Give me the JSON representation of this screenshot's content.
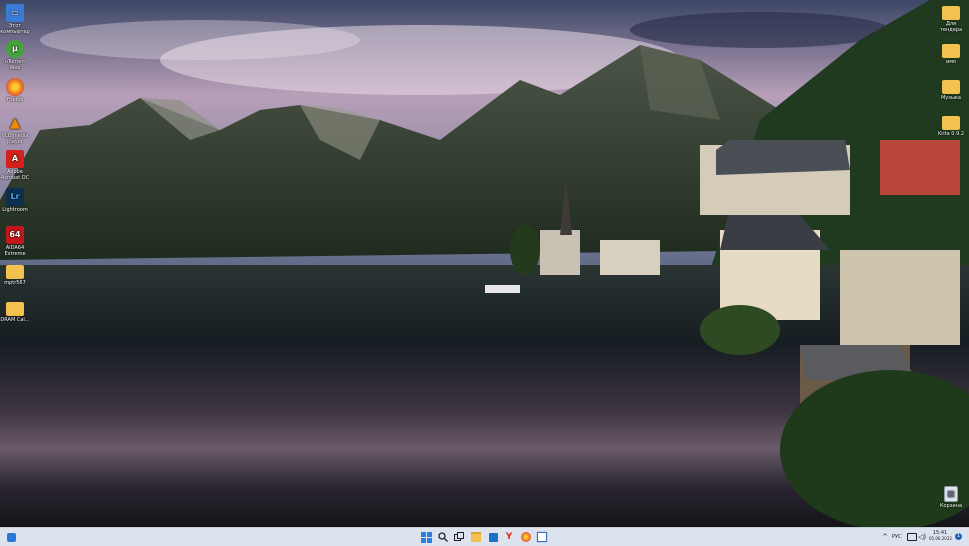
{
  "desktop_left": [
    {
      "name": "this-pc",
      "label": "Этот компьютер",
      "color": "#3a7bd5",
      "glyph": "▭"
    },
    {
      "name": "utorrent",
      "label": "uTorrent Web",
      "color": "#41a33a",
      "glyph": "µ"
    },
    {
      "name": "firefox",
      "label": "Firefox",
      "color": "#e86a1f",
      "glyph": "◉"
    },
    {
      "name": "vlc",
      "label": "VLC media player",
      "color": "#f08a00",
      "glyph": "▲"
    },
    {
      "name": "acrobat",
      "label": "Adobe Acrobat DC",
      "color": "#d2211b",
      "glyph": "A"
    },
    {
      "name": "lightroom",
      "label": "Lightroom",
      "color": "#0d2f4f",
      "glyph": "Lr"
    },
    {
      "name": "aida64",
      "label": "AIDA64 Extreme",
      "color": "#c2161c",
      "glyph": "64"
    },
    {
      "name": "folder-mptr",
      "label": "mptr567",
      "color": "#f2c14e",
      "glyph": ""
    },
    {
      "name": "folder-dram",
      "label": "DRAM Cal...",
      "color": "#f2c14e",
      "glyph": ""
    }
  ],
  "desktop_right": [
    {
      "name": "folder-teacher",
      "label": "Для тендера",
      "color": "#f2c14e"
    },
    {
      "name": "folder-imo",
      "label": "имо",
      "color": "#f2c14e"
    },
    {
      "name": "folder-music",
      "label": "Музыка",
      "color": "#f2c14e"
    },
    {
      "name": "folder-krita",
      "label": "Krita 0.9.2",
      "color": "#f2c14e"
    }
  ],
  "recycle_bin": {
    "label": "Корзина"
  },
  "taskbar": {
    "language": "РУС",
    "time": "15:41",
    "date": "05.06.2022",
    "notification_count": "1"
  }
}
